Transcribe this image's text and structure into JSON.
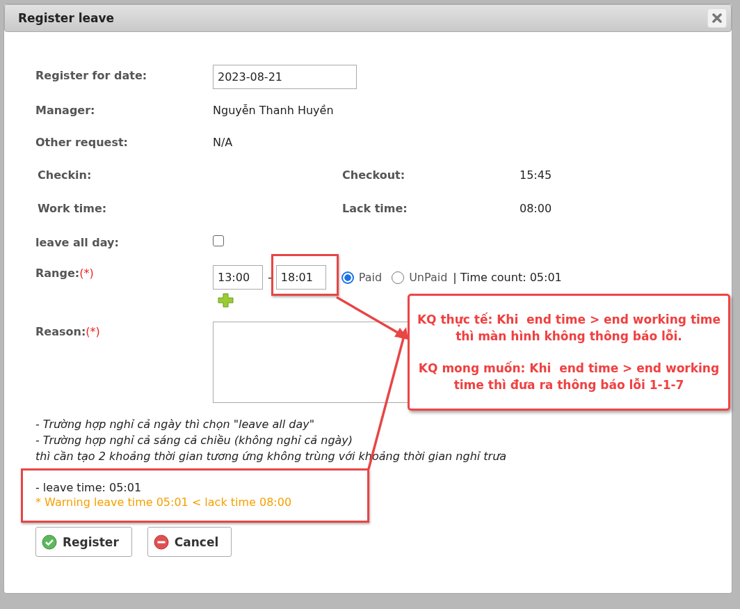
{
  "dialog": {
    "title": "Register leave"
  },
  "fields": [
    {
      "label": "Register for date:",
      "kind": "input",
      "value": "2023-08-21"
    },
    {
      "label": "Manager:",
      "kind": "text",
      "value": "Nguyễn Thanh Huyền"
    },
    {
      "label": "Other request:",
      "kind": "text",
      "value": "N/A"
    }
  ],
  "attendance": [
    {
      "label": "Checkin:"
    },
    {
      "label": "Checkout:",
      "value": "15:45"
    },
    {
      "label": "Work time:"
    },
    {
      "label": "Lack time:",
      "value": "08:00"
    }
  ],
  "leave_all_day": {
    "label": "leave all day:",
    "checked": false
  },
  "range": {
    "label": "Range:",
    "required": "(*)",
    "start": "13:00",
    "separator": "-",
    "end": "18:01",
    "pay_types": [
      {
        "label": "Paid",
        "selected": true
      },
      {
        "label": "UnPaid",
        "selected": false
      }
    ],
    "time_count": "| Time count: 05:01"
  },
  "reason": {
    "label": "Reason:",
    "required": "(*)"
  },
  "notes": [
    "- Trường hợp nghỉ cả ngày thì chọn \"leave all day\"",
    "- Trường hợp nghỉ cả sáng cả chiều (không nghỉ cả ngày)",
    "thì cần tạo 2 khoảng thời gian tương ứng không trùng với khoảng thời gian nghỉ trưa"
  ],
  "leave_time": "- leave time: 05:01",
  "warning": "* Warning leave time 05:01 < lack time 08:00",
  "buttons": [
    {
      "label": "Register",
      "kind": "confirm"
    },
    {
      "label": "Cancel",
      "kind": "cancel"
    }
  ],
  "annotation": {
    "paragraphs": [
      "KQ thực tế: Khi  end time > end working time thì màn hình không thông báo lỗi.",
      "KQ mong muốn: Khi  end time > end working time thì đưa ra thông báo lỗi 1-1-7"
    ]
  }
}
